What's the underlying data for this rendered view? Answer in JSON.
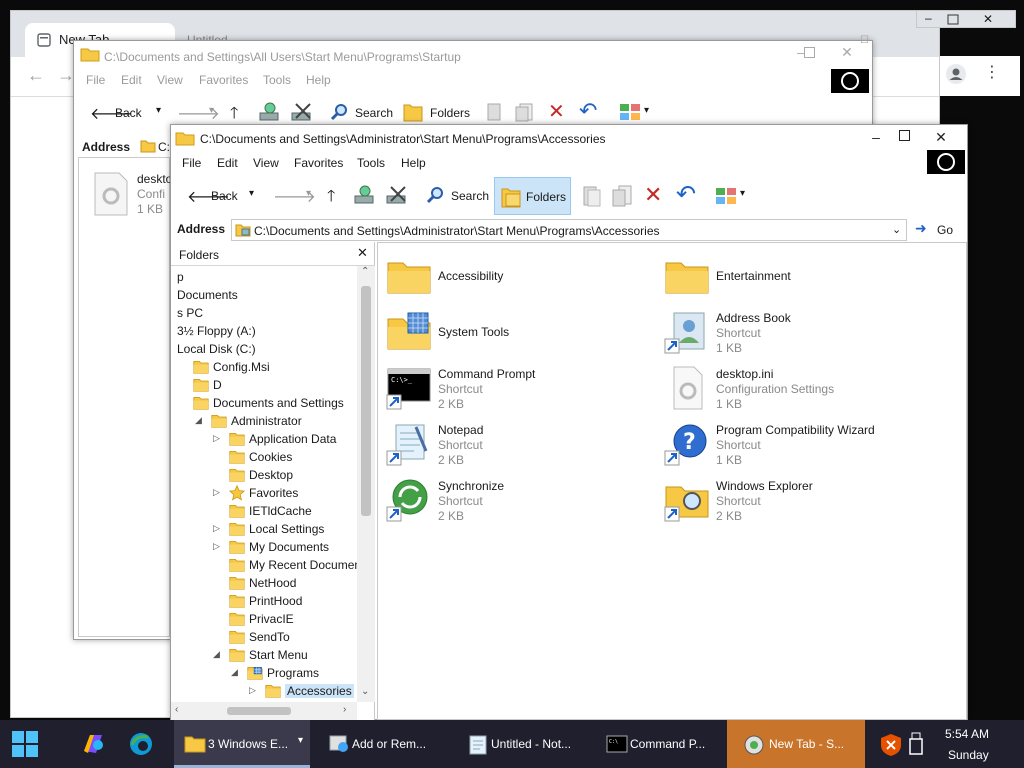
{
  "browser": {
    "tab_label": "New Tab",
    "tab2_label": "Untitled - Notepad"
  },
  "back_window": {
    "title": "C:\\Documents and Settings\\All Users\\Start Menu\\Programs\\Startup",
    "menu": [
      "File",
      "Edit",
      "View",
      "Favorites",
      "Tools",
      "Help"
    ],
    "toolbar": {
      "back": "Back",
      "search": "Search",
      "folders": "Folders"
    },
    "address_label": "Address",
    "address_value": "C:",
    "file": {
      "name": "deskto",
      "type": "Confi",
      "size": "1 KB"
    }
  },
  "front_window": {
    "title": "C:\\Documents and Settings\\Administrator\\Start Menu\\Programs\\Accessories",
    "menu": [
      "File",
      "Edit",
      "View",
      "Favorites",
      "Tools",
      "Help"
    ],
    "toolbar": {
      "back": "Back",
      "search": "Search",
      "folders": "Folders"
    },
    "address_label": "Address",
    "address_value": "C:\\Documents and Settings\\Administrator\\Start Menu\\Programs\\Accessories",
    "go_label": "Go",
    "folders_title": "Folders",
    "tree": [
      {
        "label": "p",
        "indent": 0,
        "icon": "none",
        "expander": ""
      },
      {
        "label": "Documents",
        "indent": 0,
        "icon": "none",
        "expander": ""
      },
      {
        "label": "s PC",
        "indent": 0,
        "icon": "none",
        "expander": ""
      },
      {
        "label": "3½ Floppy (A:)",
        "indent": 0,
        "icon": "none",
        "expander": ""
      },
      {
        "label": "Local Disk (C:)",
        "indent": 0,
        "icon": "none",
        "expander": ""
      },
      {
        "label": "Config.Msi",
        "indent": 1,
        "icon": "folder",
        "expander": ""
      },
      {
        "label": "D",
        "indent": 1,
        "icon": "folder",
        "expander": ""
      },
      {
        "label": "Documents and Settings",
        "indent": 1,
        "icon": "folder",
        "expander": ""
      },
      {
        "label": "Administrator",
        "indent": 2,
        "icon": "folder",
        "expander": "open"
      },
      {
        "label": "Application Data",
        "indent": 3,
        "icon": "folder",
        "expander": "closed"
      },
      {
        "label": "Cookies",
        "indent": 3,
        "icon": "folder",
        "expander": ""
      },
      {
        "label": "Desktop",
        "indent": 3,
        "icon": "folder",
        "expander": ""
      },
      {
        "label": "Favorites",
        "indent": 3,
        "icon": "star",
        "expander": "closed"
      },
      {
        "label": "IETldCache",
        "indent": 3,
        "icon": "folder",
        "expander": ""
      },
      {
        "label": "Local Settings",
        "indent": 3,
        "icon": "folder",
        "expander": "closed"
      },
      {
        "label": "My Documents",
        "indent": 3,
        "icon": "folder",
        "expander": "closed"
      },
      {
        "label": "My Recent Documents",
        "indent": 3,
        "icon": "folder",
        "expander": ""
      },
      {
        "label": "NetHood",
        "indent": 3,
        "icon": "folder",
        "expander": ""
      },
      {
        "label": "PrintHood",
        "indent": 3,
        "icon": "folder",
        "expander": ""
      },
      {
        "label": "PrivacIE",
        "indent": 3,
        "icon": "folder",
        "expander": ""
      },
      {
        "label": "SendTo",
        "indent": 3,
        "icon": "folder",
        "expander": ""
      },
      {
        "label": "Start Menu",
        "indent": 3,
        "icon": "folder",
        "expander": "open"
      },
      {
        "label": "Programs",
        "indent": 4,
        "icon": "folder-grid",
        "expander": "open"
      },
      {
        "label": "Accessories",
        "indent": 5,
        "icon": "folder",
        "expander": "closed",
        "selected": true
      }
    ],
    "items": [
      {
        "name": "Accessibility",
        "type": "",
        "size": "",
        "icon": "folder"
      },
      {
        "name": "Entertainment",
        "type": "",
        "size": "",
        "icon": "folder"
      },
      {
        "name": "System Tools",
        "type": "",
        "size": "",
        "icon": "folder-grid"
      },
      {
        "name": "Address Book",
        "type": "Shortcut",
        "size": "1 KB",
        "icon": "address-book"
      },
      {
        "name": "Command Prompt",
        "type": "Shortcut",
        "size": "2 KB",
        "icon": "cmd"
      },
      {
        "name": "desktop.ini",
        "type": "Configuration Settings",
        "size": "1 KB",
        "icon": "ini"
      },
      {
        "name": "Notepad",
        "type": "Shortcut",
        "size": "2 KB",
        "icon": "notepad"
      },
      {
        "name": "Program Compatibility Wizard",
        "type": "Shortcut",
        "size": "1 KB",
        "icon": "help"
      },
      {
        "name": "Synchronize",
        "type": "Shortcut",
        "size": "2 KB",
        "icon": "sync"
      },
      {
        "name": "Windows Explorer",
        "type": "Shortcut",
        "size": "2 KB",
        "icon": "explorer"
      }
    ]
  },
  "taskbar": {
    "buttons": [
      {
        "label": "3 Windows E...",
        "app": "explorer"
      },
      {
        "label": "Add or Rem...",
        "app": "addremove"
      },
      {
        "label": "Untitled - Not...",
        "app": "notepad"
      },
      {
        "label": "Command P...",
        "app": "cmd"
      },
      {
        "label": "New Tab - S...",
        "app": "browser"
      }
    ],
    "time": "5:54 AM",
    "day": "Sunday"
  },
  "colors": {
    "folder_yellow": "#f6c844",
    "taskbar": "#1f1f2e",
    "active_task": "#c8742a",
    "selection": "#cce4f7"
  }
}
